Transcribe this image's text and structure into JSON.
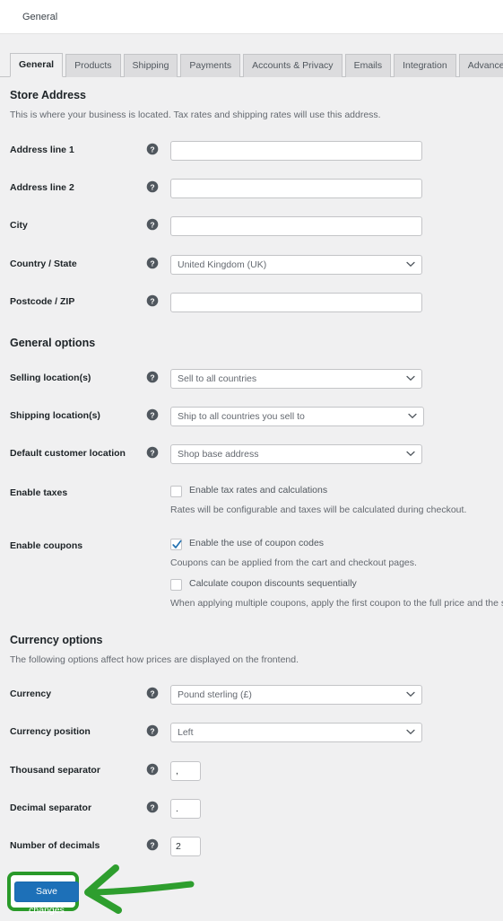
{
  "topbar": {
    "title": "General"
  },
  "tabs": [
    {
      "label": "General",
      "active": true
    },
    {
      "label": "Products",
      "active": false
    },
    {
      "label": "Shipping",
      "active": false
    },
    {
      "label": "Payments",
      "active": false
    },
    {
      "label": "Accounts & Privacy",
      "active": false
    },
    {
      "label": "Emails",
      "active": false
    },
    {
      "label": "Integration",
      "active": false
    },
    {
      "label": "Advanced",
      "active": false
    }
  ],
  "store_address": {
    "title": "Store Address",
    "description": "This is where your business is located. Tax rates and shipping rates will use this address.",
    "address_line_1": {
      "label": "Address line 1",
      "value": "",
      "placeholder": "",
      "help": "help-icon"
    },
    "address_line_2": {
      "label": "Address line 2",
      "value": "",
      "placeholder": "",
      "help": "help-icon"
    },
    "city": {
      "label": "City",
      "value": "",
      "placeholder": "",
      "help": "help-icon"
    },
    "country_state": {
      "label": "Country / State",
      "value": "United Kingdom (UK)",
      "help": "help-icon"
    },
    "postcode_zip": {
      "label": "Postcode / ZIP",
      "value": "",
      "placeholder": "",
      "help": "help-icon"
    }
  },
  "general_options": {
    "title": "General options",
    "selling_locations": {
      "label": "Selling location(s)",
      "value": "Sell to all countries"
    },
    "shipping_locations": {
      "label": "Shipping location(s)",
      "value": "Ship to all countries you sell to"
    },
    "default_customer_location": {
      "label": "Default customer location",
      "value": "Shop base address"
    },
    "enable_taxes": {
      "label": "Enable taxes",
      "checkbox_label": "Enable tax rates and calculations",
      "checked": false,
      "description": "Rates will be configurable and taxes will be calculated during checkout."
    },
    "enable_coupons": {
      "label": "Enable coupons",
      "checkbox_label": "Enable the use of coupon codes",
      "checked": true,
      "description": "Coupons can be applied from the cart and checkout pages.",
      "sequential_label": "Calculate coupon discounts sequentially",
      "sequential_checked": false,
      "sequential_description": "When applying multiple coupons, apply the first coupon to the full price and the second"
    }
  },
  "currency_options": {
    "title": "Currency options",
    "description": "The following options affect how prices are displayed on the frontend.",
    "currency": {
      "label": "Currency",
      "value": "Pound sterling (£)"
    },
    "currency_position": {
      "label": "Currency position",
      "value": "Left"
    },
    "thousand_separator": {
      "label": "Thousand separator",
      "value": ","
    },
    "decimal_separator": {
      "label": "Decimal separator",
      "value": "."
    },
    "number_of_decimals": {
      "label": "Number of decimals",
      "value": "2"
    }
  },
  "footer": {
    "save_label": "Save changes"
  },
  "annotation": {
    "highlight_color": "#2a9a2a",
    "arrow_color": "#2e9e2e",
    "arrow_direction": "left",
    "target": "save-changes-button"
  },
  "colors": {
    "page_background": "#f0f0f1",
    "primary_button": "#1d70b8",
    "checkbox_check": "#2271b1",
    "text": "#3c434a"
  }
}
